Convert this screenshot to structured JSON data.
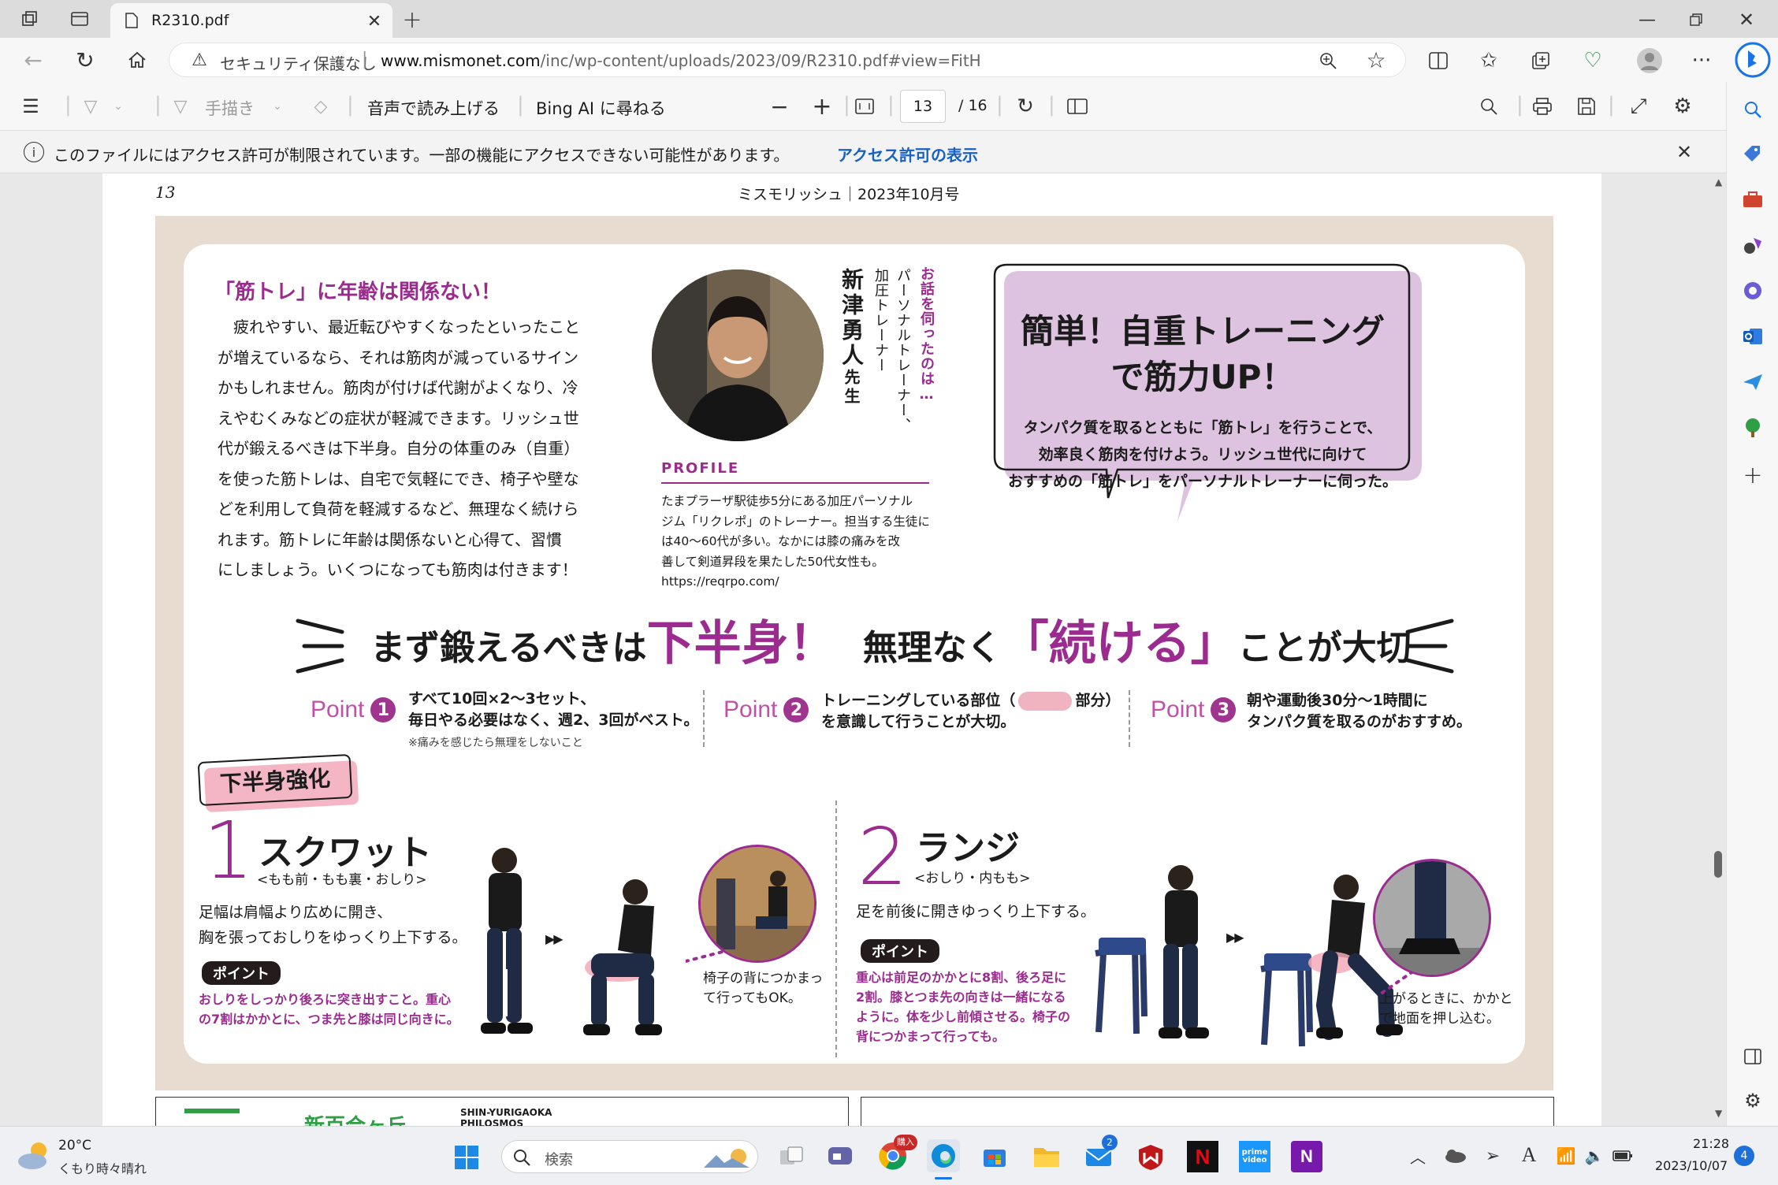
{
  "browser": {
    "tab_title": "R2310.pdf",
    "security_label": "セキュリティ保護なし",
    "url_domain": "www.mismonet.com",
    "url_path": "/inc/wp-content/uploads/2023/09/R2310.pdf#view=FitH"
  },
  "pdf_toolbar": {
    "draw_label": "手描き",
    "read_aloud_label": "音声で読み上げる",
    "bing_label": "Bing AI に尋ねる",
    "page_current": "13",
    "page_total": "/ 16"
  },
  "notice": {
    "text": "このファイルにはアクセス許可が制限されています。一部の機能にアクセスできない可能性があります。",
    "link": "アクセス許可の表示"
  },
  "pdf_page": {
    "page_number": "13",
    "header": "ミスモリッシュ｜2023年10月号",
    "intro_title": "「筋トレ」に年齢は関係ない！",
    "intro_lines": [
      "　疲れやすい、最近転びやすくなったといったこと",
      "が増えているなら、それは筋肉が減っているサイン",
      "かもしれません。筋肉が付けば代謝がよくなり、冷",
      "えやむくみなどの症状が軽減できます。リッシュ世",
      "代が鍛えるべきは下半身。自分の体重のみ（自重）",
      "を使った筋トレは、自宅で気軽にでき、椅子や壁な",
      "どを利用して負荷を軽減するなど、無理なく続けら",
      "れます。筋トレに年齢は関係ないと心得て、習慣",
      "にしましょう。いくつになっても筋肉は付きます！"
    ],
    "trainer_intro": "お話を伺ったのは…",
    "trainer_role_1": "パーソナルトレーナー、",
    "trainer_role_2": "加圧トレーナー",
    "trainer_name": "新津勇人",
    "trainer_suffix": "先生",
    "profile_label": "PROFILE",
    "profile_lines": [
      "たまプラーザ駅徒歩5分にある加圧パーソナル",
      "ジム「リクレポ」のトレーナー。担当する生徒に",
      "は40～60代が多い。なかには膝の痛みを改",
      "善して剣道昇段を果たした50代女性も。",
      "https://reqrpo.com/"
    ],
    "bubble_title_1": "簡単！自重トレーニング",
    "bubble_title_2": "で筋力UP！",
    "bubble_body": [
      "タンパク質を取るとともに「筋トレ」を行うことで、",
      "効率良く筋肉を付けよう。リッシュ世代に向けて",
      "おすすめの「筋トレ」をパーソナルトレーナーに伺った。"
    ],
    "headline_a": "まず鍛えるべきは",
    "headline_b": "下半身！",
    "headline_c": "無理なく",
    "headline_d": "「続ける」",
    "headline_e": "ことが大切",
    "points": [
      {
        "label": "Point",
        "num": "1",
        "text": "すべて10回×2～3セット、\n毎日やる必要はなく、週2、3回がベスト。",
        "note": "※痛みを感じたら無理をしないこと"
      },
      {
        "label": "Point",
        "num": "2",
        "text_a": "トレーニングしている部位（",
        "text_b": "部分）",
        "text_c": "を意識して行うことが大切。"
      },
      {
        "label": "Point",
        "num": "3",
        "text": "朝や運動後30分～1時間に\nタンパク質を取るのがおすすめ。"
      }
    ],
    "section_tag": "下半身強化",
    "ex1": {
      "num": "1",
      "title": "スクワット",
      "sub": "<もも前・もも裏・おしり>",
      "desc_1": "足幅は肩幅より広めに開き、",
      "desc_2": "胸を張っておしりをゆっくり上下する。",
      "tag": "ポイント",
      "tip_1": "おしりをしっかり後ろに突き出すこと。重心",
      "tip_2": "の7割はかかとに、つま先と膝は同じ向きに。",
      "note_1": "椅子の背につかまっ",
      "note_2": "て行ってもOK。"
    },
    "ex2": {
      "num": "2",
      "title": "ランジ",
      "sub": "<おしり・内もも>",
      "desc_1": "足を前後に開きゆっくり上下する。",
      "tag": "ポイント",
      "tip_1": "重心は前足のかかとに8割、後ろ足に",
      "tip_2": "2割。膝とつま先の向きは一緒になる",
      "tip_3": "ように。体を少し前傾させる。椅子の",
      "tip_4": "背につかまって行っても。",
      "note_1": "上がるときに、かかと",
      "note_2": "で地面を押し込む。"
    },
    "ad_text": "新百合ヶ丘",
    "ad_sub_1": "SHIN-YURIGAOKA",
    "ad_sub_2": "PHILOSMOS"
  },
  "taskbar": {
    "weather_temp": "20°C",
    "weather_desc": "くもり時々晴れ",
    "search_placeholder": "検索",
    "time": "21:28",
    "date": "2023/10/07",
    "notification_count": "4",
    "chrome_badge": "購入",
    "mail_badge": "2"
  },
  "colors": {
    "accent_purple": "#9b2b8f",
    "bubble_fill": "#dcc1de",
    "beige": "#e8dcd0",
    "pink": "#f0b3c0"
  }
}
